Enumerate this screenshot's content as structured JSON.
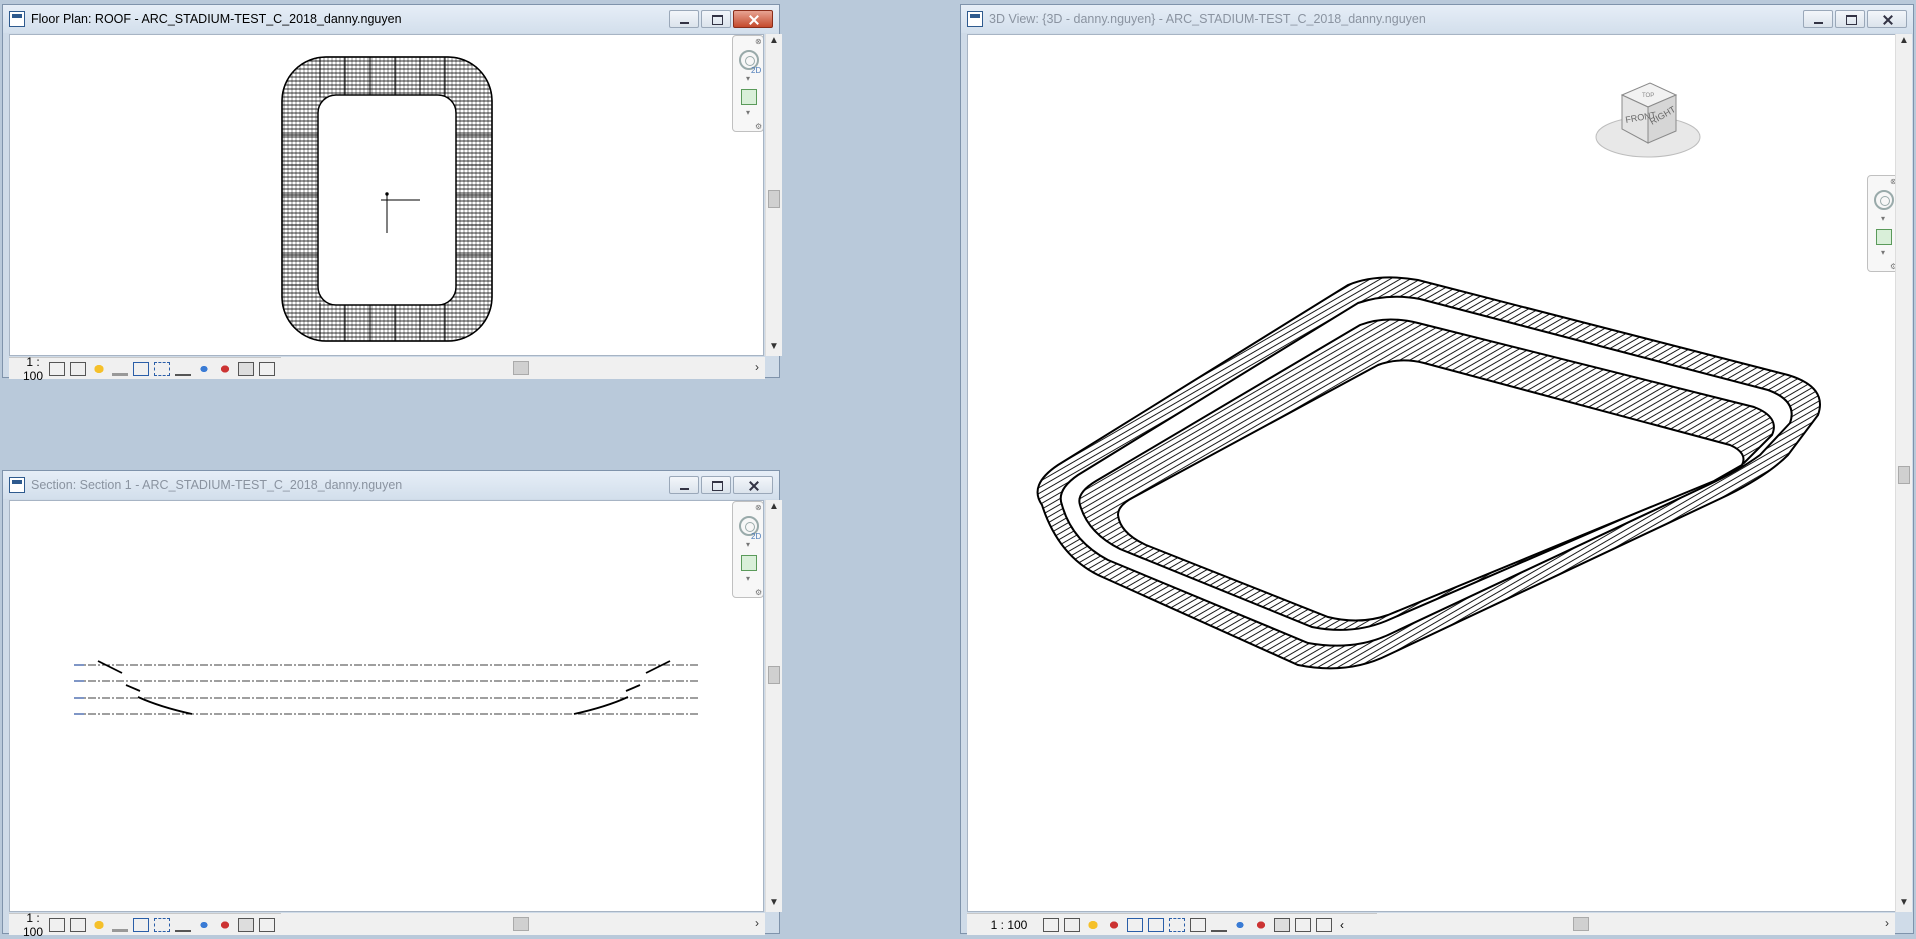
{
  "windows": {
    "floorplan": {
      "title": "Floor Plan: ROOF - ARC_STADIUM-TEST_C_2018_danny.nguyen",
      "scale": "1 : 100",
      "active": true
    },
    "section": {
      "title": "Section: Section 1 - ARC_STADIUM-TEST_C_2018_danny.nguyen",
      "scale": "1 : 100",
      "active": false
    },
    "view3d": {
      "title": "3D View: {3D - danny.nguyen} - ARC_STADIUM-TEST_C_2018_danny.nguyen",
      "scale": "1 : 100",
      "active": false
    }
  },
  "viewcube": {
    "front": "FRONT",
    "right": "RIGHT",
    "top": "TOP"
  },
  "navbar": {
    "label_2d": "2D"
  },
  "view_controls": [
    "detail-level-icon",
    "visual-style-icon",
    "sun-path-icon",
    "shadows-icon",
    "crop-view-icon",
    "show-crop-icon",
    "temporary-hide-icon",
    "reveal-hidden-icon",
    "analytical-model-icon",
    "highlight-displacement-icon",
    "reveal-constraints-icon"
  ],
  "colors": {
    "titlebar": "#dbe5f0",
    "close_active": "#c44a2c",
    "workspace": "#b9c9da"
  }
}
